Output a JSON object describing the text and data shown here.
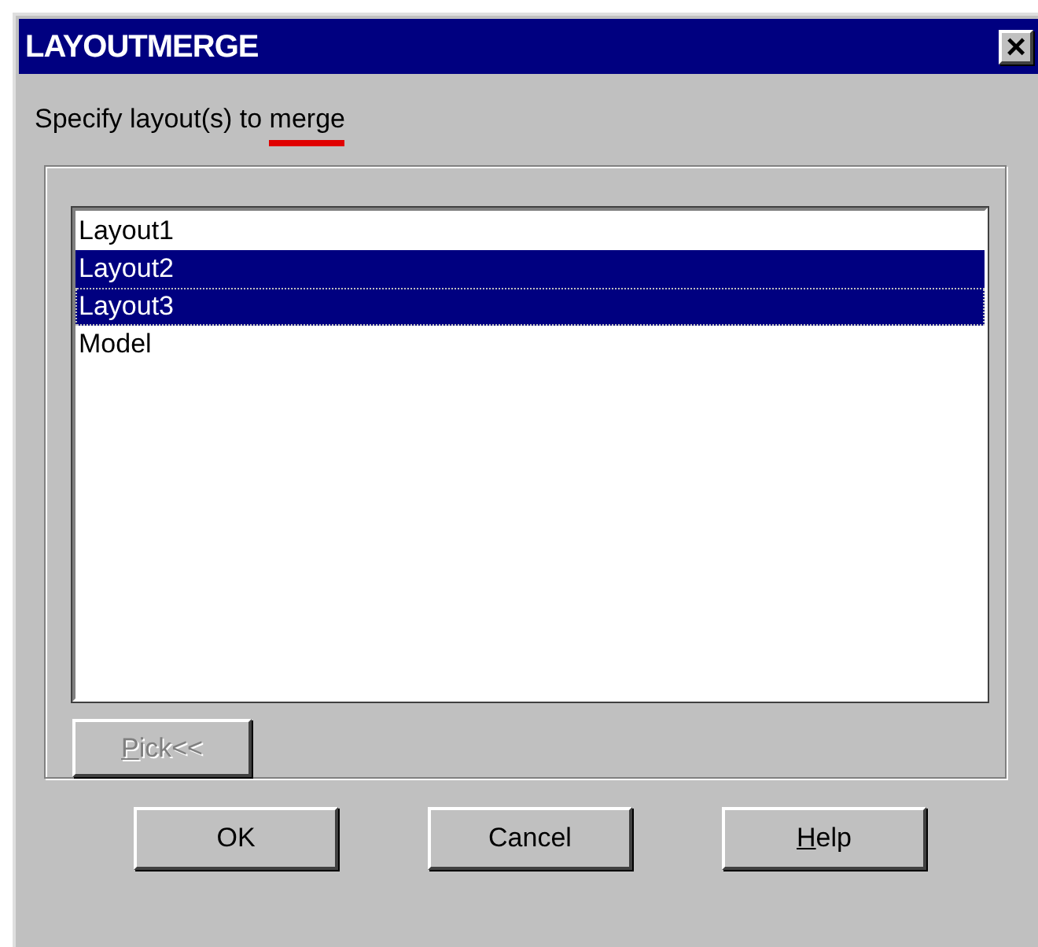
{
  "window": {
    "title": "LAYOUTMERGE",
    "close": "×"
  },
  "prompt": {
    "lead": "Specify layout(s) to",
    "marked": "merge",
    "underlined": true
  },
  "layouts": [
    {
      "label": "Layout1",
      "selected": false,
      "focused": false
    },
    {
      "label": "Layout2",
      "selected": true,
      "focused": false
    },
    {
      "label": "Layout3",
      "selected": true,
      "focused": true
    },
    {
      "label": "Model",
      "selected": false,
      "focused": false
    }
  ],
  "pick_button": {
    "label": "Pick<<",
    "disabled": true,
    "accelerator": true
  },
  "buttons": [
    {
      "label": "OK",
      "accelerator": false
    },
    {
      "label": "Cancel",
      "accelerator": false
    },
    {
      "label": "Help",
      "accelerator": true
    }
  ]
}
